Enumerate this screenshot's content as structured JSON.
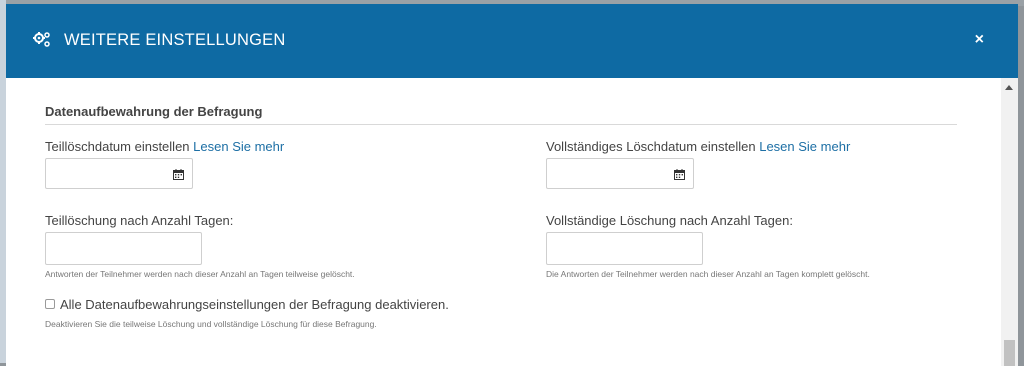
{
  "modal": {
    "title": "WEITERE EINSTELLUNGEN",
    "close_label": "×"
  },
  "section": {
    "title": "Datenaufbewahrung der Befragung"
  },
  "left": {
    "date_label": "Teillöschdatum einstellen",
    "date_link": "Lesen Sie mehr",
    "days_label": "Teillöschung nach Anzahl Tagen:",
    "days_help": "Antworten der Teilnehmer werden nach dieser Anzahl an Tagen teilweise gelöscht."
  },
  "right": {
    "date_label": "Vollständiges Löschdatum einstellen",
    "date_link": "Lesen Sie mehr",
    "days_label": "Vollständige Löschung nach Anzahl Tagen:",
    "days_help": "Die Antworten der Teilnehmer werden nach dieser Anzahl an Tagen komplett gelöscht."
  },
  "disable": {
    "label": "Alle Datenaufbewahrungseinstellungen der Befragung deaktivieren.",
    "help": "Deaktivieren Sie die teilweise Löschung und vollständige Löschung für diese Befragung."
  },
  "icons": {
    "header": "gears-icon",
    "close": "close-icon",
    "calendar": "calendar-icon"
  },
  "colors": {
    "header": "#0e6aa3",
    "link": "#1d6fa5"
  }
}
